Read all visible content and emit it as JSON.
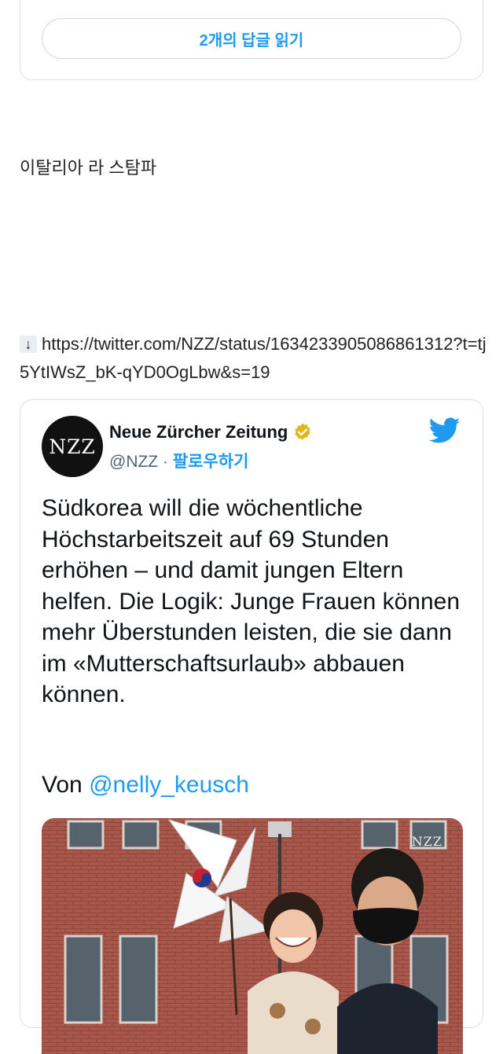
{
  "card1": {
    "read_replies_label": "2개의 답글 읽기"
  },
  "post": {
    "text": "이탈리아 라 스탐파"
  },
  "link": {
    "arrow": "↓",
    "url": "https://twitter.com/NZZ/status/1634233905086861312?t=tj5YtIWsZ_bK-qYD0OgLbw&s=19"
  },
  "tweet": {
    "avatar_text": "NZZ",
    "author_name": "Neue Zürcher Zeitung",
    "handle": "@NZZ",
    "separator": "·",
    "follow_label": "팔로우하기",
    "body": "Südkorea will die wöchentliche Höchstarbeitszeit auf 69 Stunden erhöhen – und damit jungen Eltern helfen. Die Logik: Junge Frauen können mehr Überstunden leisten, die sie dann im «Mutterschaftsurlaub» abbauen können.",
    "von_label": "Von",
    "mention": "@nelly_keusch",
    "media_watermark": "NZZ"
  },
  "colors": {
    "accent": "#1d9bf0",
    "verified": "#e2b719",
    "text": "#0f1419",
    "muted": "#536471",
    "border": "#dbe0e4"
  },
  "icons": {
    "verified": "verified-badge-icon",
    "bird": "twitter-bird-icon",
    "arrow": "down-arrow-icon"
  }
}
